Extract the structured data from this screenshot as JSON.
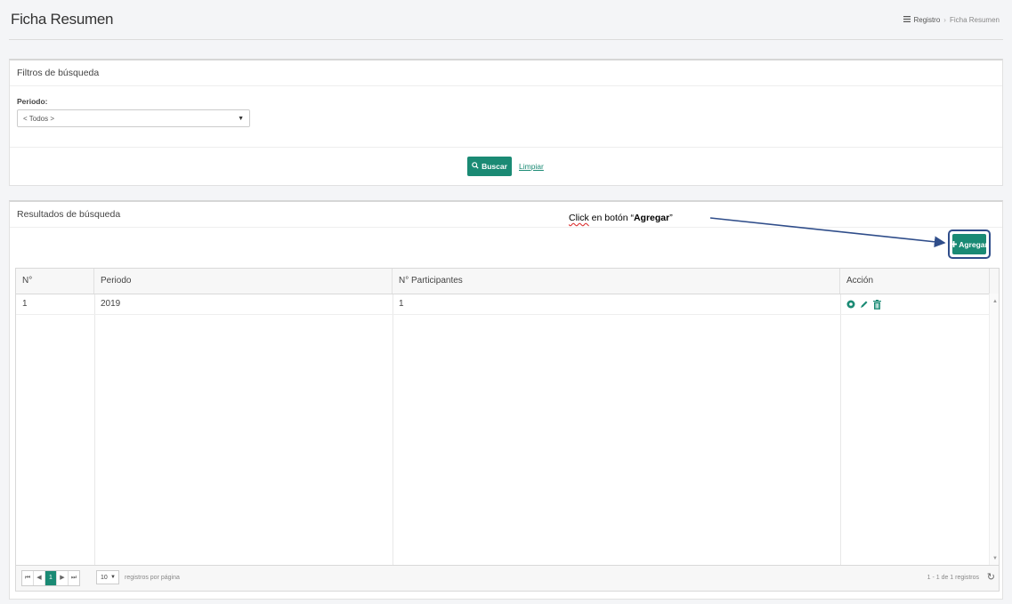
{
  "header": {
    "title": "Ficha Resumen",
    "breadcrumb": [
      "Registro",
      "Ficha Resumen"
    ]
  },
  "filters": {
    "title": "Filtros de búsqueda",
    "periodo_label": "Periodo:",
    "periodo_value": "< Todos >",
    "buscar_label": "Buscar",
    "limpiar_label": "Limpiar"
  },
  "results": {
    "title": "Resultados de búsqueda",
    "annotation_pre": "Click",
    "annotation_mid": " en botón “",
    "annotation_bold": "Agregar",
    "annotation_post": "”",
    "agregar_label": "Agregar",
    "columns": [
      "N°",
      "Periodo",
      "N° Participantes",
      "Acción"
    ],
    "rows": [
      {
        "n": "1",
        "periodo": "2019",
        "participantes": "1"
      }
    ],
    "pager": {
      "current_page": "1",
      "page_size": "10",
      "page_size_label": "registros por página",
      "info": "1 - 1 de 1 registros"
    }
  },
  "colors": {
    "accent": "#1a8a74",
    "highlight": "#2f4d8a"
  }
}
